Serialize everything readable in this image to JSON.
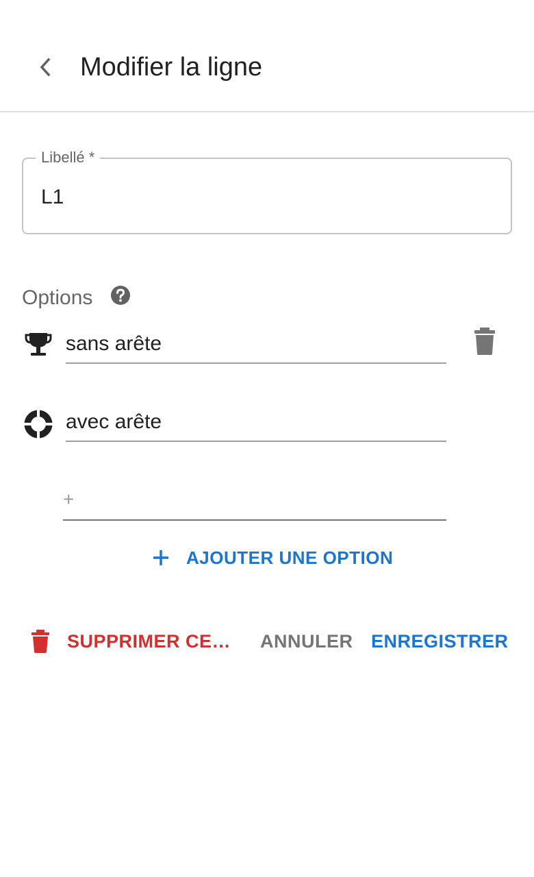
{
  "header": {
    "title": "Modifier la ligne",
    "back_icon": "chevron-left-icon"
  },
  "label_field": {
    "label": "Libellé *",
    "value": "L1"
  },
  "options": {
    "title": "Options",
    "help_icon": "help-circle-icon",
    "items": [
      {
        "label": "sans arête",
        "icon": "trophy-icon"
      },
      {
        "label": "avec arête",
        "icon": "lifebuoy-icon"
      }
    ],
    "new_placeholder": "+",
    "add_label": "AJOUTER UNE OPTION",
    "delete_icon": "trash-icon"
  },
  "footer": {
    "delete_label": "SUPPRIMER CE…",
    "cancel_label": "ANNULER",
    "save_label": "ENREGISTRER"
  },
  "colors": {
    "primary": "#1976d2",
    "danger": "#d32f2f",
    "muted": "#757575"
  }
}
